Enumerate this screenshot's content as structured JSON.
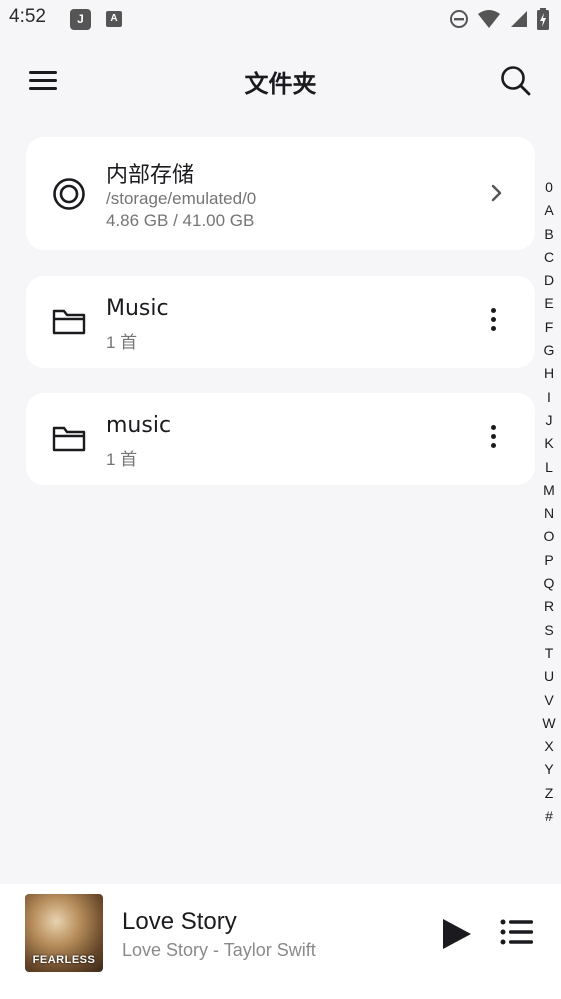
{
  "status_bar": {
    "time": "4:52",
    "app_icons": [
      "J",
      "A"
    ]
  },
  "app_bar": {
    "title": "文件夹"
  },
  "storage": {
    "name": "内部存储",
    "path": "/storage/emulated/0",
    "usage": "4.86 GB / 41.00 GB"
  },
  "folders": [
    {
      "name": "Music",
      "count": "1 首"
    },
    {
      "name": "music",
      "count": "1 首"
    }
  ],
  "index_letters": [
    "0",
    "A",
    "B",
    "C",
    "D",
    "E",
    "F",
    "G",
    "H",
    "I",
    "J",
    "K",
    "L",
    "M",
    "N",
    "O",
    "P",
    "Q",
    "R",
    "S",
    "T",
    "U",
    "V",
    "W",
    "X",
    "Y",
    "Z",
    "#"
  ],
  "player": {
    "title": "Love Story",
    "subtitle": "Love Story - Taylor Swift",
    "album_text": "FEARLESS"
  },
  "colors": {
    "background": "#f6f6f9",
    "card": "#ffffff",
    "text": "#1b1b1f",
    "secondary_text": "#757575"
  },
  "icons": {
    "menu": "menu-icon",
    "search": "search-icon",
    "storage": "storage-icon",
    "chevron": "chevron-right-icon",
    "folder": "folder-icon",
    "more": "more-vert-icon",
    "play": "play-icon",
    "queue": "queue-icon"
  }
}
